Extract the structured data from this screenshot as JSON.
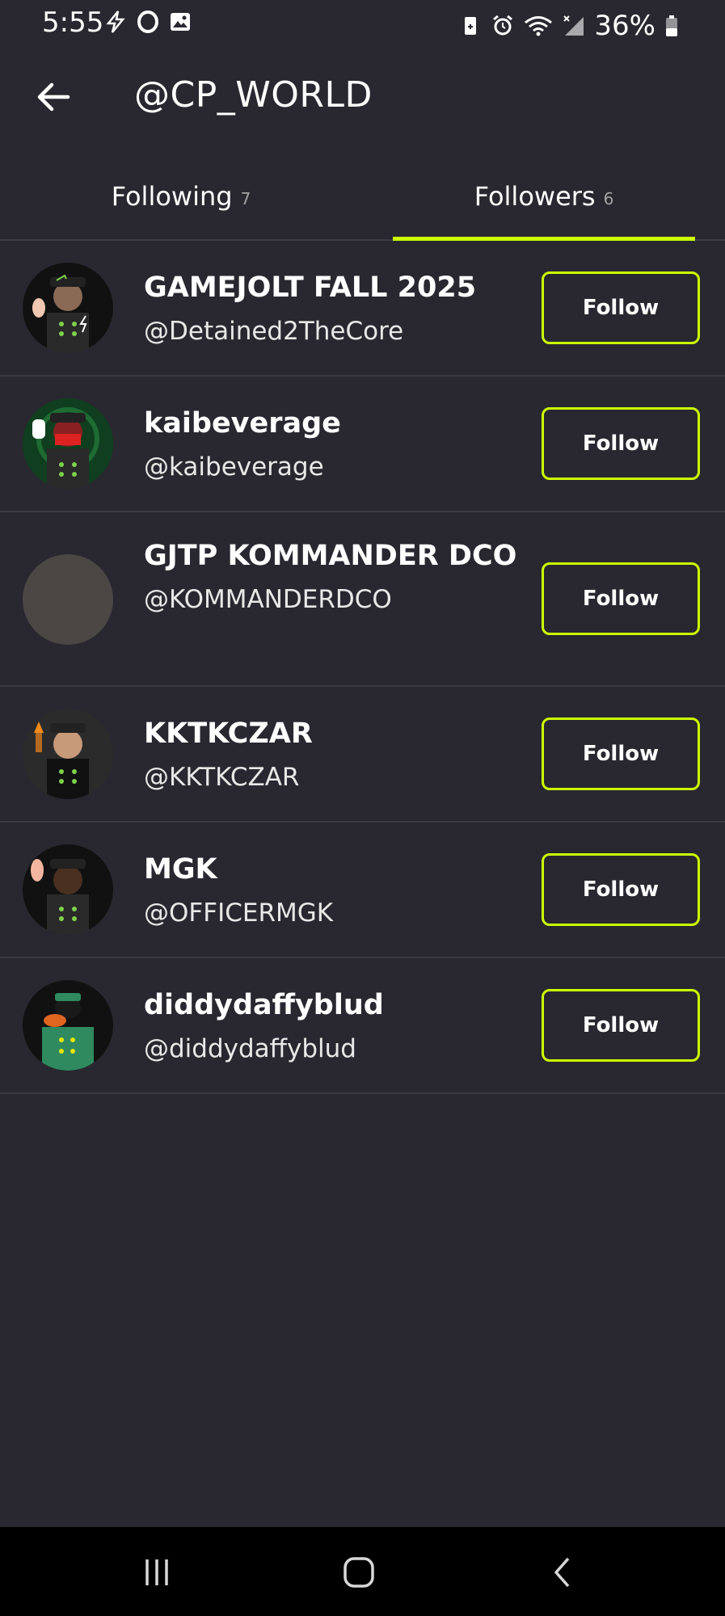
{
  "status_bar": {
    "time": "5:55",
    "battery_percent": "36%",
    "left_icons": [
      "bolt-icon",
      "opera-icon",
      "gallery-icon"
    ],
    "right_icons": [
      "battery-saver-icon",
      "alarm-icon",
      "wifi-icon",
      "signal-icon",
      "battery-icon"
    ]
  },
  "header": {
    "title": "@CP_WORLD",
    "back_icon": "arrow-left-icon"
  },
  "tabs": [
    {
      "label": "Following",
      "count": "7",
      "active": false
    },
    {
      "label": "Followers",
      "count": "6",
      "active": true
    }
  ],
  "accent_color": "#ccff00",
  "background_color": "#292830",
  "followers": [
    {
      "display_name": "GAMEJOLT FALL 2025",
      "handle": "@Detained2TheCore",
      "button_label": "Follow",
      "avatar": "officer-avatar"
    },
    {
      "display_name": "kaibeverage",
      "handle": "@kaibeverage",
      "button_label": "Follow",
      "avatar": "masked-officer-avatar"
    },
    {
      "display_name": "GJTP KOMMANDER DCO",
      "handle": "@KOMMANDERDCO",
      "button_label": "Follow",
      "avatar": "blank-avatar"
    },
    {
      "display_name": "KKTKCZAR",
      "handle": "@KKTKCZAR",
      "button_label": "Follow",
      "avatar": "officer-torch-avatar"
    },
    {
      "display_name": "MGK",
      "handle": "@OFFICERMGK",
      "button_label": "Follow",
      "avatar": "officer-salute-avatar"
    },
    {
      "display_name": "diddydaffyblud",
      "handle": "@diddydaffyblud",
      "button_label": "Follow",
      "avatar": "duck-officer-avatar"
    }
  ],
  "nav_bar": {
    "recents_icon": "recents-icon",
    "home_icon": "home-icon",
    "back_icon": "back-chevron-icon"
  }
}
